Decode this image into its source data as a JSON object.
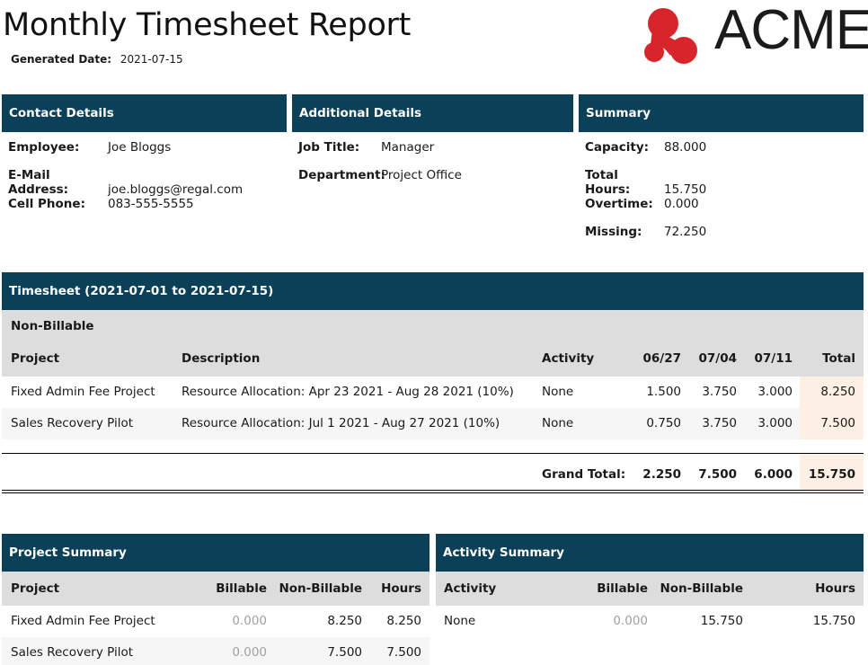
{
  "report": {
    "title": "Monthly Timesheet Report",
    "generated_label": "Generated Date:",
    "generated_value": "2021-07-15",
    "logo_text": "ACME"
  },
  "contact": {
    "header": "Contact Details",
    "rows": [
      {
        "label": "Employee:",
        "value": "Joe Bloggs"
      },
      {
        "label": "E-Mail Address:",
        "value": "joe.bloggs@regal.com"
      },
      {
        "label": "Cell Phone:",
        "value": "083-555-5555"
      }
    ]
  },
  "additional": {
    "header": "Additional Details",
    "rows": [
      {
        "label": "Job Title:",
        "value": "Manager"
      },
      {
        "label": "Department:",
        "value": "Project Office"
      }
    ]
  },
  "summary": {
    "header": "Summary",
    "rows": [
      {
        "label": "Capacity:",
        "value": "88.000"
      },
      {
        "label": "Total Hours:",
        "value": "15.750"
      },
      {
        "label": "Overtime:",
        "value": "0.000"
      },
      {
        "label": "Missing:",
        "value": "72.250"
      }
    ]
  },
  "timesheet": {
    "header": "Timesheet (2021-07-01 to 2021-07-15)",
    "group": "Non-Billable",
    "columns": [
      "Project",
      "Description",
      "Activity",
      "06/27",
      "07/04",
      "07/11",
      "Total"
    ],
    "rows": [
      {
        "project": "Fixed Admin Fee Project",
        "description": "Resource Allocation: Apr 23 2021 - Aug 28 2021 (10%)",
        "activity": "None",
        "w1": "1.500",
        "w2": "3.750",
        "w3": "3.000",
        "total": "8.250"
      },
      {
        "project": "Sales Recovery Pilot",
        "description": "Resource Allocation: Jul 1 2021 - Aug 27 2021 (10%)",
        "activity": "None",
        "w1": "0.750",
        "w2": "3.750",
        "w3": "3.000",
        "total": "7.500"
      }
    ],
    "grand_total": {
      "label": "Grand Total:",
      "w1": "2.250",
      "w2": "7.500",
      "w3": "6.000",
      "total": "15.750"
    }
  },
  "project_summary": {
    "header": "Project Summary",
    "columns": [
      "Project",
      "Billable",
      "Non-Billable",
      "Hours"
    ],
    "rows": [
      {
        "project": "Fixed Admin Fee Project",
        "billable": "0.000",
        "non_billable": "8.250",
        "hours": "8.250"
      },
      {
        "project": "Sales Recovery Pilot",
        "billable": "0.000",
        "non_billable": "7.500",
        "hours": "7.500"
      }
    ]
  },
  "activity_summary": {
    "header": "Activity Summary",
    "columns": [
      "Activity",
      "Billable",
      "Non-Billable",
      "Hours"
    ],
    "rows": [
      {
        "activity": "None",
        "billable": "0.000",
        "non_billable": "15.750",
        "hours": "15.750"
      }
    ]
  },
  "colors": {
    "header_bg": "#0b4059",
    "logo_red": "#d6262b",
    "grey_band": "#dddddd",
    "total_highlight": "#fcefe3"
  }
}
